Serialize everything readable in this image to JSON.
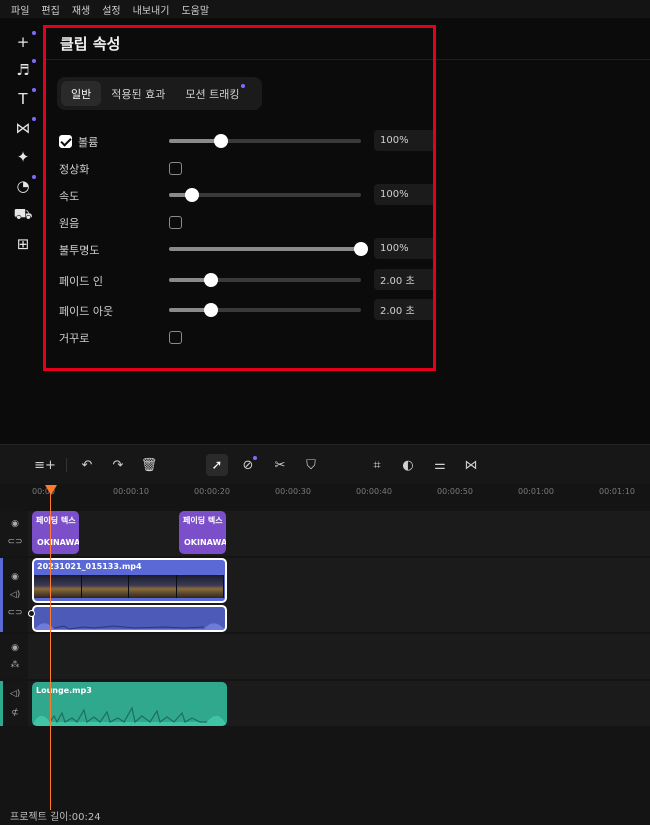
{
  "menu": [
    "파일",
    "편집",
    "재생",
    "설정",
    "내보내기",
    "도움말"
  ],
  "sidebar_icons": [
    {
      "name": "add-media-icon",
      "glyph": "+",
      "dot": true
    },
    {
      "name": "music-icon",
      "glyph": "♬",
      "dot": true
    },
    {
      "name": "text-icon",
      "glyph": "T",
      "dot": true
    },
    {
      "name": "transition-icon",
      "glyph": "⋈",
      "dot": true
    },
    {
      "name": "effects-icon",
      "glyph": "✦",
      "dot": false
    },
    {
      "name": "filter-icon",
      "glyph": "◔",
      "dot": true
    },
    {
      "name": "elements-icon",
      "glyph": "⛟",
      "dot": false
    },
    {
      "name": "templates-icon",
      "glyph": "⊞",
      "dot": false
    }
  ],
  "panel": {
    "title": "클립 속성",
    "tabs": [
      {
        "label": "일반",
        "active": true,
        "dot": false
      },
      {
        "label": "적용된 효과",
        "active": false,
        "dot": false
      },
      {
        "label": "모션 트래킹",
        "active": false,
        "dot": true
      }
    ],
    "properties": [
      {
        "label": "볼륨",
        "control": "slider",
        "checkbox": "checked",
        "level": 0.27,
        "value": "100%"
      },
      {
        "label": "정상화",
        "control": "checkbox",
        "checked": false
      },
      {
        "label": "속도",
        "control": "slider",
        "level": 0.12,
        "value": "100%"
      },
      {
        "label": "원음",
        "control": "checkbox",
        "checked": false
      },
      {
        "label": "불투명도",
        "control": "slider",
        "level": 1.0,
        "value": "100%"
      },
      {
        "label": "페이드 인",
        "control": "slider",
        "level": 0.22,
        "value": "2.00 초"
      },
      {
        "label": "페이드 아웃",
        "control": "slider",
        "level": 0.22,
        "value": "2.00 초"
      },
      {
        "label": "거꾸로",
        "control": "checkbox",
        "checked": false
      }
    ]
  },
  "timeline": {
    "ruler": [
      "00:00",
      "00:00:10",
      "00:00:20",
      "00:00:30",
      "00:00:40",
      "00:00:50",
      "00:01:00",
      "00:01:10"
    ],
    "text_clips": [
      {
        "top": "페이딩 텍스",
        "bottom": "OKINAWA"
      },
      {
        "top": "페이딩 텍스",
        "bottom": "OKINAWA"
      }
    ],
    "video_clip": "20231021_015133.mp4",
    "music_clip": "Lounge.mp3",
    "project_length": "프로젝트 길이:00:24"
  },
  "colors": {
    "accent": "#7b6cff",
    "highlight": "#e3001b",
    "playhead": "#ff7a2a",
    "text_clip": "#7a4fc9",
    "video_clip": "#5b69d6",
    "music_clip": "#2fa88e"
  }
}
